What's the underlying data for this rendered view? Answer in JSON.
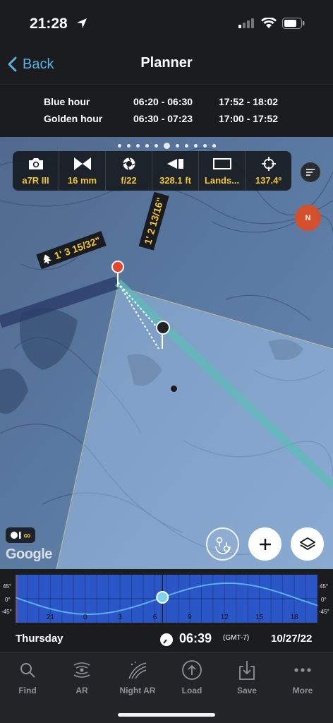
{
  "status": {
    "time": "21:28"
  },
  "nav": {
    "back_label": "Back",
    "title": "Planner"
  },
  "light_hours": [
    {
      "label": "Blue hour",
      "morning": "06:20 - 06:30",
      "evening": "17:52 - 18:02"
    },
    {
      "label": "Golden hour",
      "morning": "06:30 - 07:23",
      "evening": "17:00 - 17:52"
    }
  ],
  "toolbar": {
    "camera": "a7R III",
    "focal_length": "16 mm",
    "aperture": "f/22",
    "distance": "328.1 ft",
    "orientation": "Lands...",
    "azimuth": "137.4º"
  },
  "map": {
    "page_dots": 11,
    "active_dot": 5,
    "label_elevation": "1' 3 15/32\"",
    "label_distance": "1' 2 13/16\"",
    "compass_letter": "N",
    "moon_toggle": "∞",
    "attribution": "Google"
  },
  "timeline": {
    "hour_labels": [
      "21",
      "0",
      "3",
      "6",
      "9",
      "12",
      "15",
      "18"
    ],
    "altitude_ticks": [
      "45°",
      "0°",
      "-45°"
    ],
    "current_hour": 6.65
  },
  "date_row": {
    "day": "Thursday",
    "time": "06:39",
    "timezone": "(GMT-7)",
    "date": "10/27/22"
  },
  "tabs": [
    {
      "label": "Find",
      "icon": "search-icon"
    },
    {
      "label": "AR",
      "icon": "ar-icon"
    },
    {
      "label": "Night AR",
      "icon": "night-ar-icon"
    },
    {
      "label": "Load",
      "icon": "load-icon"
    },
    {
      "label": "Save",
      "icon": "save-icon"
    },
    {
      "label": "More",
      "icon": "more-icon"
    }
  ],
  "colors": {
    "accent": "#5ab1e6",
    "value_yellow": "#f3c638",
    "pin_red": "#e5462a",
    "compass": "#d4502d"
  }
}
